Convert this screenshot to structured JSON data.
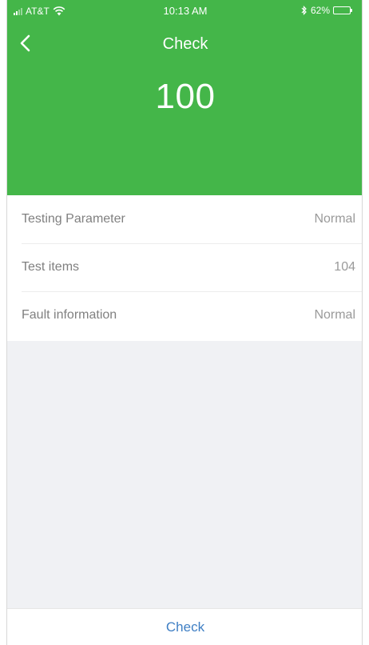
{
  "colors": {
    "accent": "#44b649",
    "link": "#3f7fc4"
  },
  "status_bar": {
    "carrier": "AT&T",
    "time": "10:13 AM",
    "battery": "62%",
    "battery_level": 0.62
  },
  "nav": {
    "title": "Check",
    "back_icon": "chevron-left-icon"
  },
  "score": {
    "value": "100"
  },
  "items": [
    {
      "label": "Testing Parameter",
      "value": "Normal"
    },
    {
      "label": "Test items",
      "value": "104"
    },
    {
      "label": "Fault information",
      "value": "Normal"
    }
  ],
  "footer": {
    "check_label": "Check"
  }
}
